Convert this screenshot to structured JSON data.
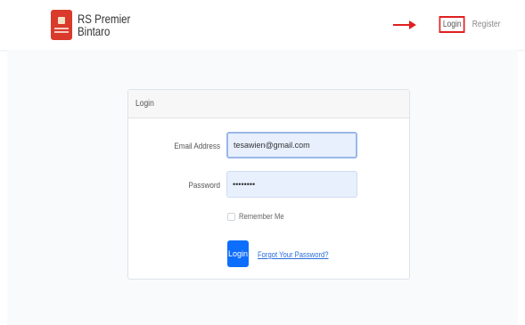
{
  "navbar": {
    "brand_line1": "RS Premier",
    "brand_line2": "Bintaro",
    "login_label": "Login",
    "register_label": "Register"
  },
  "card": {
    "header": "Login",
    "email_label": "Email Address",
    "email_value": "tesawien@gmail.com",
    "password_label": "Password",
    "password_value": "••••••••",
    "remember_label": "Remember Me",
    "login_button": "Login",
    "forgot_link": "Forgot Your Password?"
  },
  "colors": {
    "primary": "#0d6efd",
    "annotation_red": "#e02020",
    "input_bg": "#e8f0fe",
    "logo_red": "#d93a2b"
  },
  "icons": {
    "logo": "hospital-logo-icon",
    "annotation": "arrow-right-icon"
  }
}
